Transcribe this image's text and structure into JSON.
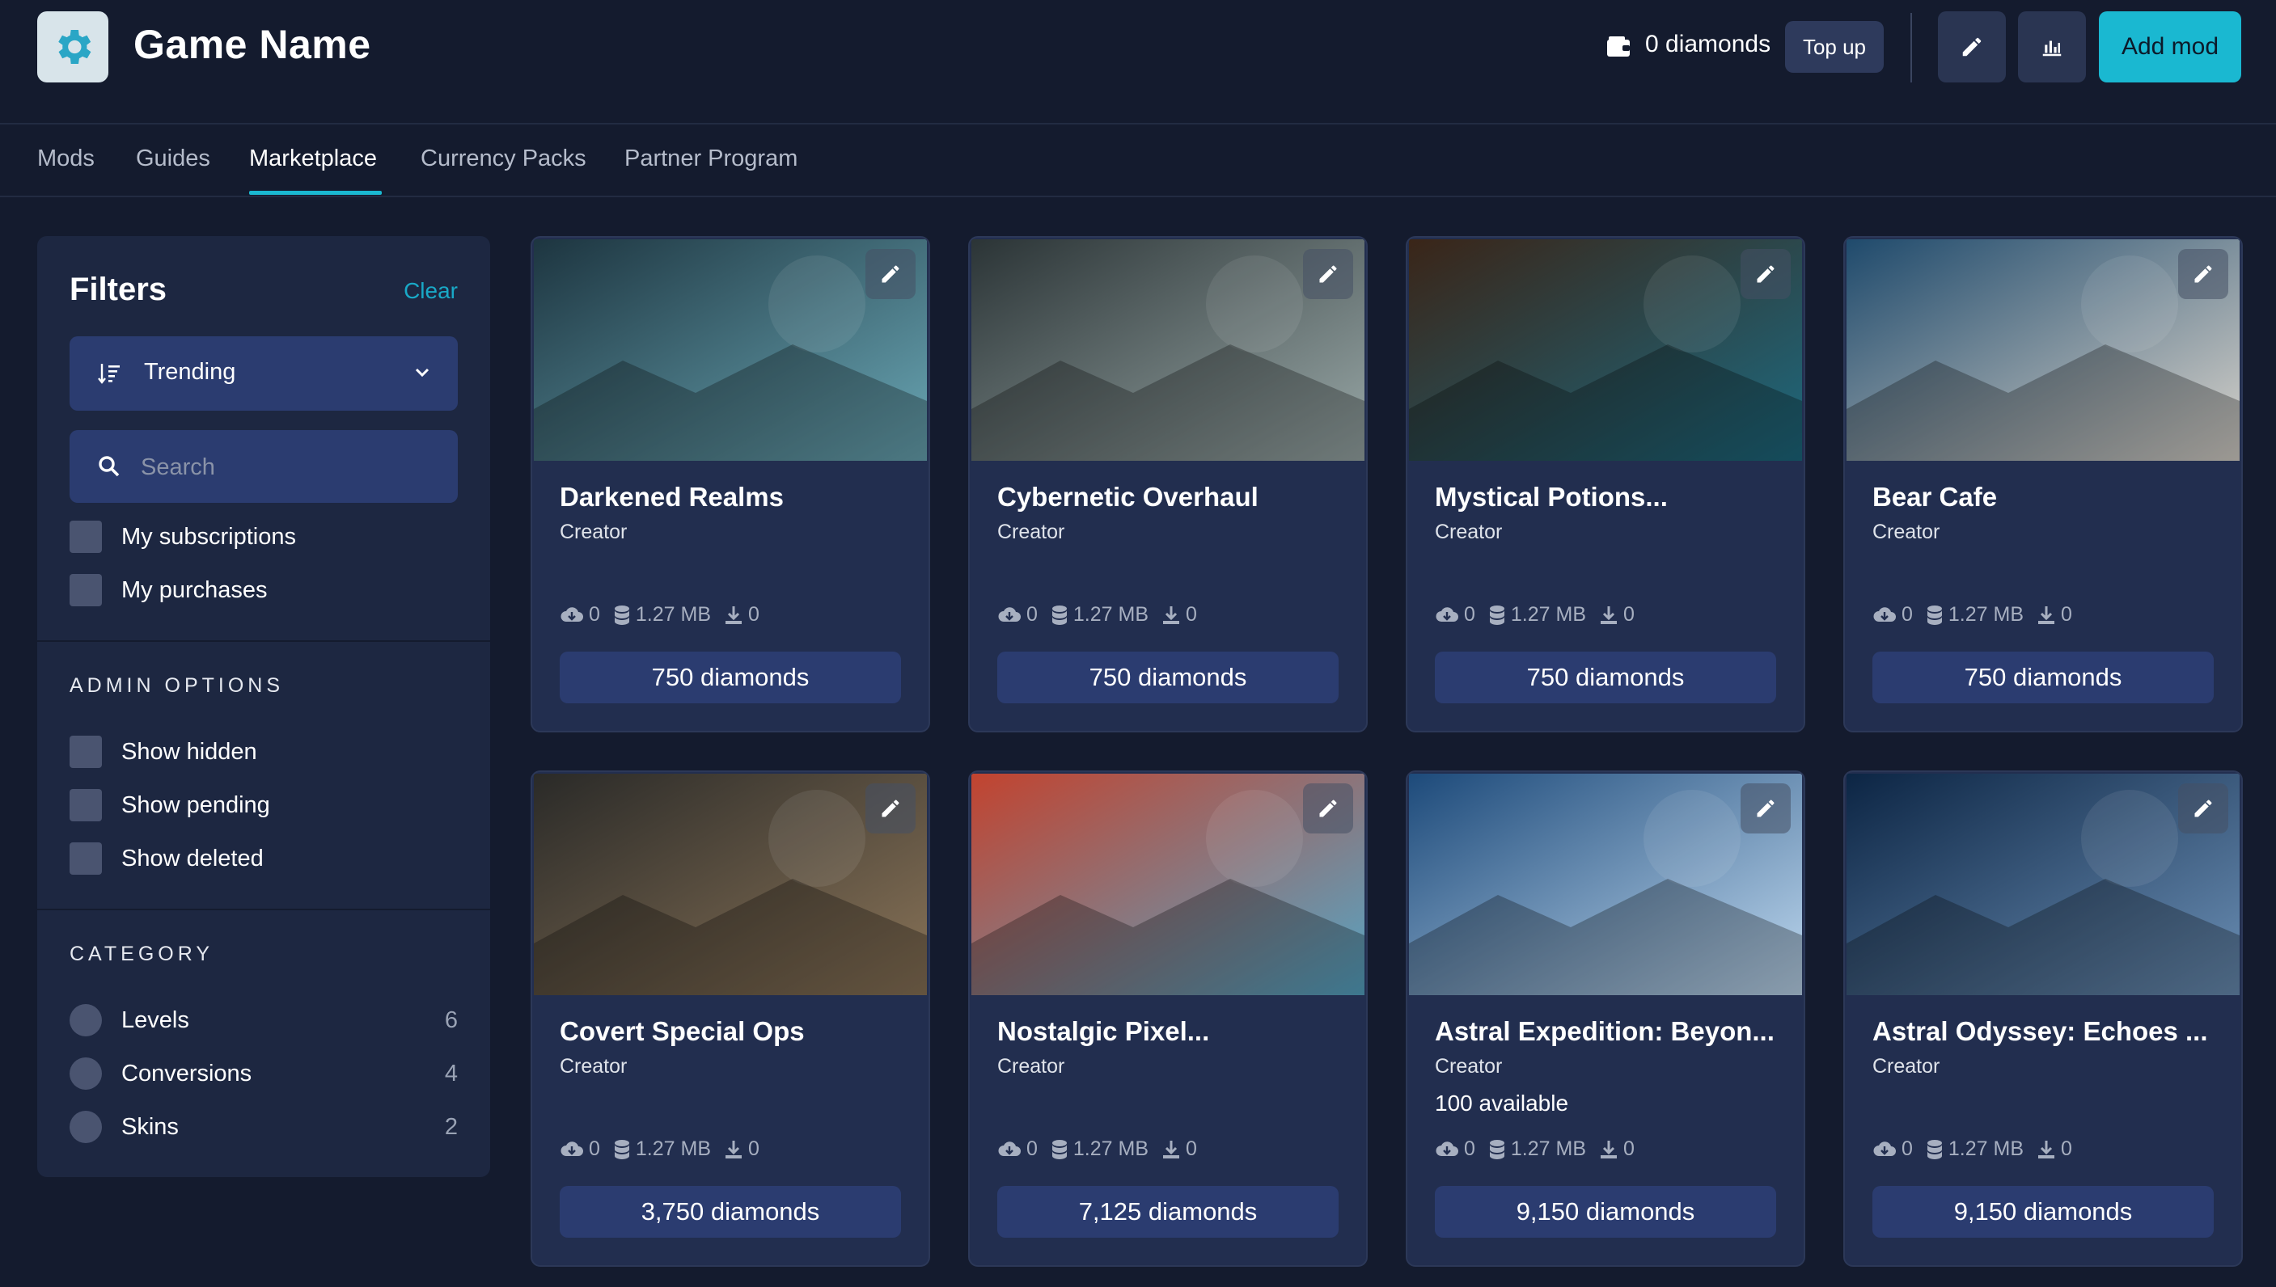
{
  "header": {
    "title": "Game Name",
    "wallet_text": "0 diamonds",
    "topup_label": "Top up",
    "add_mod_label": "Add mod",
    "logo_icon": "gear-icon",
    "accent": "#1ab8d1"
  },
  "tabs": [
    {
      "label": "Mods"
    },
    {
      "label": "Guides"
    },
    {
      "label": "Marketplace",
      "active": true
    },
    {
      "label": "Currency Packs"
    },
    {
      "label": "Partner Program"
    }
  ],
  "sidebar": {
    "title": "Filters",
    "clear_label": "Clear",
    "sort_value": "Trending",
    "search_placeholder": "Search",
    "checkboxes": [
      {
        "label": "My subscriptions"
      },
      {
        "label": "My purchases"
      }
    ],
    "admin": {
      "title": "ADMIN OPTIONS",
      "options": [
        {
          "label": "Show hidden"
        },
        {
          "label": "Show pending"
        },
        {
          "label": "Show deleted"
        }
      ]
    },
    "category": {
      "title": "CATEGORY",
      "items": [
        {
          "label": "Levels",
          "count": "6"
        },
        {
          "label": "Conversions",
          "count": "4"
        },
        {
          "label": "Skins",
          "count": "2"
        }
      ]
    }
  },
  "cards": [
    {
      "title": "Darkened Realms",
      "creator": "Creator",
      "extra": "",
      "subs": "0",
      "size": "1.27 MB",
      "downloads": "0",
      "price": "750 diamonds",
      "colors": [
        "#1d3540",
        "#6aa7b5"
      ]
    },
    {
      "title": "Cybernetic Overhaul",
      "creator": "Creator",
      "extra": "",
      "subs": "0",
      "size": "1.27 MB",
      "downloads": "0",
      "price": "750 diamonds",
      "colors": [
        "#2b3436",
        "#9aa9a8"
      ]
    },
    {
      "title": "Mystical Potions...",
      "creator": "Creator",
      "extra": "",
      "subs": "0",
      "size": "1.27 MB",
      "downloads": "0",
      "price": "750 diamonds",
      "colors": [
        "#3a2518",
        "#1d6a80"
      ]
    },
    {
      "title": "Bear Cafe",
      "creator": "Creator",
      "extra": "",
      "subs": "0",
      "size": "1.27 MB",
      "downloads": "0",
      "price": "750 diamonds",
      "colors": [
        "#1f4a6c",
        "#d9d4cc"
      ]
    },
    {
      "title": "Covert Special Ops",
      "creator": "Creator",
      "extra": "",
      "subs": "0",
      "size": "1.27 MB",
      "downloads": "0",
      "price": "3,750 diamonds",
      "colors": [
        "#2a2a28",
        "#8a7458"
      ]
    },
    {
      "title": "Nostalgic Pixel...",
      "creator": "Creator",
      "extra": "",
      "subs": "0",
      "size": "1.27 MB",
      "downloads": "0",
      "price": "7,125 diamonds",
      "colors": [
        "#c2432f",
        "#56a6c6"
      ]
    },
    {
      "title": "Astral Expedition: Beyon...",
      "creator": "Creator",
      "extra": "100 available",
      "subs": "0",
      "size": "1.27 MB",
      "downloads": "0",
      "price": "9,150 diamonds",
      "colors": [
        "#1d4a7a",
        "#bfd9f0"
      ]
    },
    {
      "title": "Astral Odyssey: Echoes ...",
      "creator": "Creator",
      "extra": "",
      "subs": "0",
      "size": "1.27 MB",
      "downloads": "0",
      "price": "9,150 diamonds",
      "colors": [
        "#0c2544",
        "#6b8fb5"
      ]
    }
  ]
}
